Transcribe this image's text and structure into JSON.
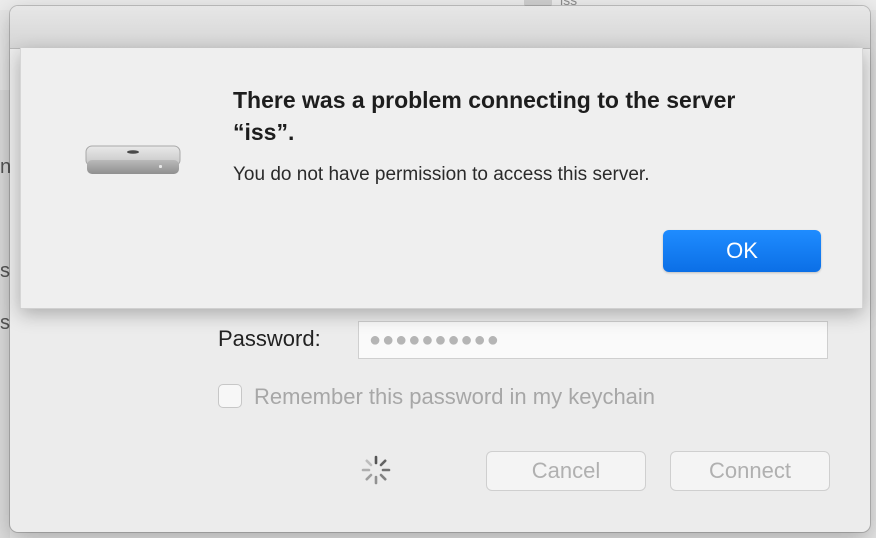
{
  "background": {
    "peek_label": "iss",
    "side_fragments": [
      "n",
      "s",
      "s"
    ]
  },
  "alert": {
    "title": "There was a problem connecting to the server “iss”.",
    "message": "You do not have permission to access this server.",
    "ok_label": "OK",
    "icon": "mac-mini-icon",
    "accent_color": "#1a82fb"
  },
  "connect_dialog": {
    "password_label": "Password:",
    "password_value": "●●●●●●●●●●",
    "remember_label": "Remember this password in my keychain",
    "remember_checked": false,
    "cancel_label": "Cancel",
    "connect_label": "Connect",
    "spinner_icon": "progress-spinner-icon"
  }
}
